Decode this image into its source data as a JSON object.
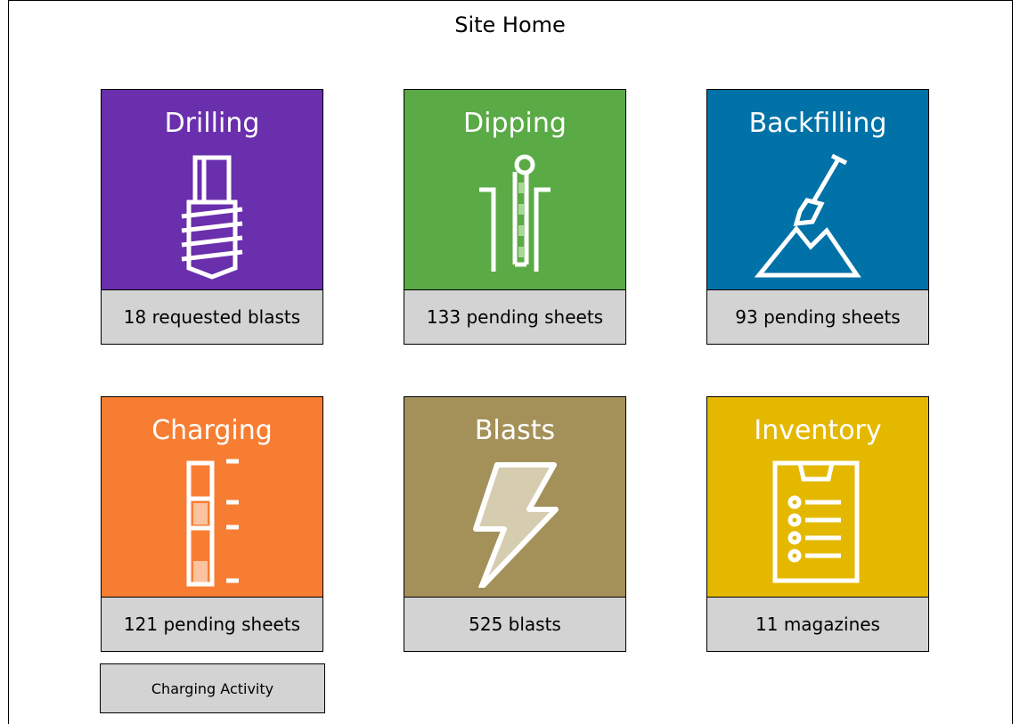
{
  "page": {
    "title": "Site Home"
  },
  "tiles": {
    "drilling": {
      "title": "Drilling",
      "subtitle": "18 requested blasts",
      "color": "#6a2fad",
      "icon": "drill-bit-icon"
    },
    "dipping": {
      "title": "Dipping",
      "subtitle": "133 pending sheets",
      "color": "#5aaa46",
      "icon": "dip-tape-icon"
    },
    "backfilling": {
      "title": "Backfilling",
      "subtitle": "93 pending sheets",
      "color": "#0072a8",
      "icon": "shovel-mountain-icon"
    },
    "charging": {
      "title": "Charging",
      "subtitle": "121 pending sheets",
      "color": "#f77d32",
      "icon": "charge-column-icon"
    },
    "blasts": {
      "title": "Blasts",
      "subtitle": "525 blasts",
      "color": "#a4915a",
      "icon": "lightning-bolt-icon"
    },
    "inventory": {
      "title": "Inventory",
      "subtitle": "11 magazines",
      "color": "#e5b800",
      "icon": "clipboard-list-icon"
    }
  },
  "buttons": {
    "charging_activity": "Charging Activity"
  }
}
